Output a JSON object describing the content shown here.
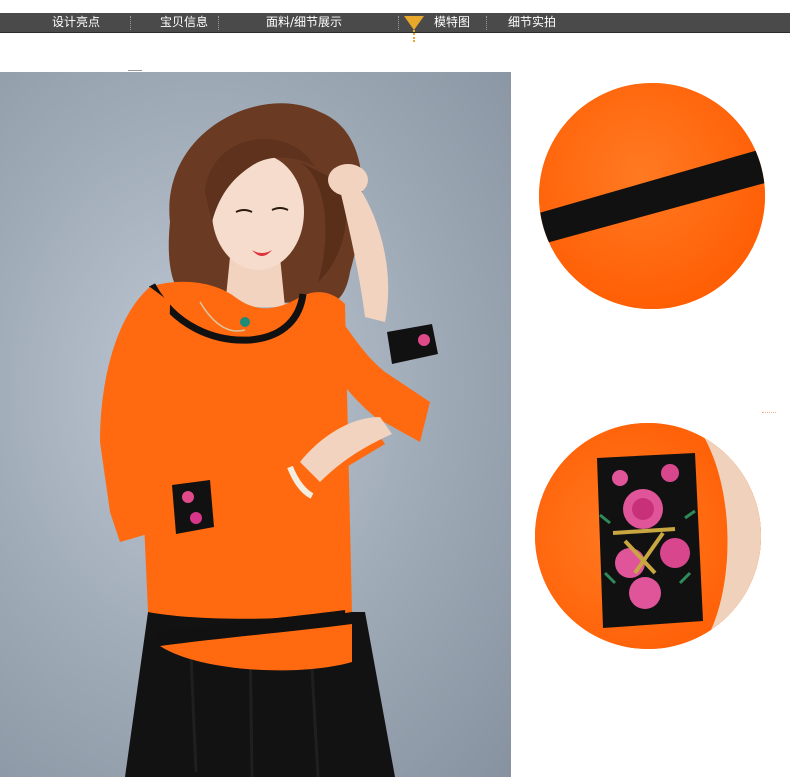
{
  "nav": {
    "items": [
      {
        "label": "设计亮点"
      },
      {
        "label": "宝贝信息"
      },
      {
        "label": "面料/细节展示"
      },
      {
        "label": "模特图"
      },
      {
        "label": "细节实拍"
      }
    ],
    "active_index": 3,
    "strip_color": "#4a4a4a",
    "marker_color": "#e8a82c"
  },
  "colors": {
    "garment_orange": "#ff6a10",
    "trim_black": "#111111",
    "background_gray": "#9ea9b6"
  },
  "icons": {
    "active_marker": "triangle-down-icon"
  }
}
